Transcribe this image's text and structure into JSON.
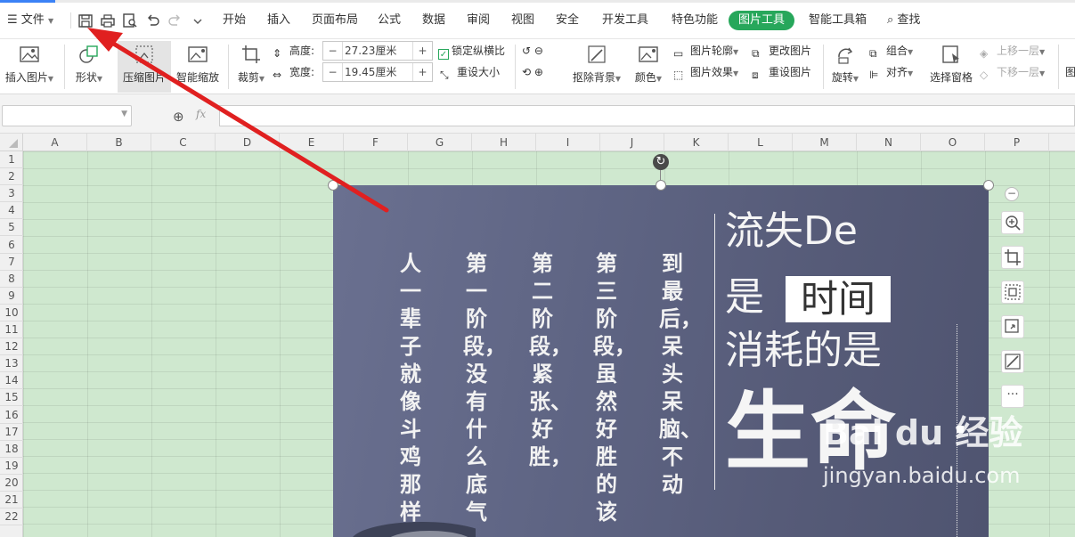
{
  "menubar": {
    "file_label": "文件",
    "tabs": [
      "开始",
      "插入",
      "页面布局",
      "公式",
      "数据",
      "审阅",
      "视图",
      "安全",
      "开发工具",
      "特色功能"
    ],
    "active_tab": "图片工具",
    "smart_toolbox": "智能工具箱",
    "search_label": "查找"
  },
  "ribbon": {
    "insert_picture": "插入图片",
    "shape": "形状",
    "compress_picture": "压缩图片",
    "smart_zoom": "智能缩放",
    "crop": "裁剪",
    "height_label": "高度:",
    "height_value": "27.23厘米",
    "width_label": "宽度:",
    "width_value": "19.45厘米",
    "lock_ratio": "锁定纵横比",
    "reset_size": "重设大小",
    "remove_background": "抠除背景",
    "color": "颜色",
    "picture_outline": "图片轮廓",
    "picture_effect": "图片效果",
    "change_picture": "更改图片",
    "reset_picture": "重设图片",
    "rotate": "旋转",
    "group": "组合",
    "align": "对齐",
    "selection_pane": "选择窗格",
    "bring_forward": "上移一层",
    "send_backward": "下移一层",
    "overflow_char": "图"
  },
  "formula": {
    "fx_label": "fx"
  },
  "columns": [
    "A",
    "B",
    "C",
    "D",
    "E",
    "F",
    "G",
    "H",
    "I",
    "J",
    "K",
    "L",
    "M",
    "N",
    "O",
    "P"
  ],
  "rows": [
    "1",
    "2",
    "3",
    "4",
    "5",
    "6",
    "7",
    "8",
    "9",
    "10",
    "11",
    "12",
    "13",
    "14",
    "15",
    "16",
    "17",
    "18",
    "19",
    "20",
    "21",
    "22"
  ],
  "picture": {
    "columns_text": [
      "到最后，呆头呆脑、不动",
      "第三阶段，虽然好胜的该",
      "第二阶段，紧张、好胜，",
      "第一阶段，没有什么底气",
      "人一辈子就像斗鸡那样可"
    ],
    "title_line1": "流失De",
    "title_line2_pre": "是",
    "title_line2_box": "时间",
    "title_line3": "消耗的是",
    "title_line4": "生命"
  },
  "watermark": {
    "brand": "Bai du 经验",
    "url": "jingyan.baidu.com"
  },
  "colors": {
    "active_tab": "#27a75b",
    "arrow": "#e02020",
    "sheet_bg": "#cfe8cf"
  }
}
